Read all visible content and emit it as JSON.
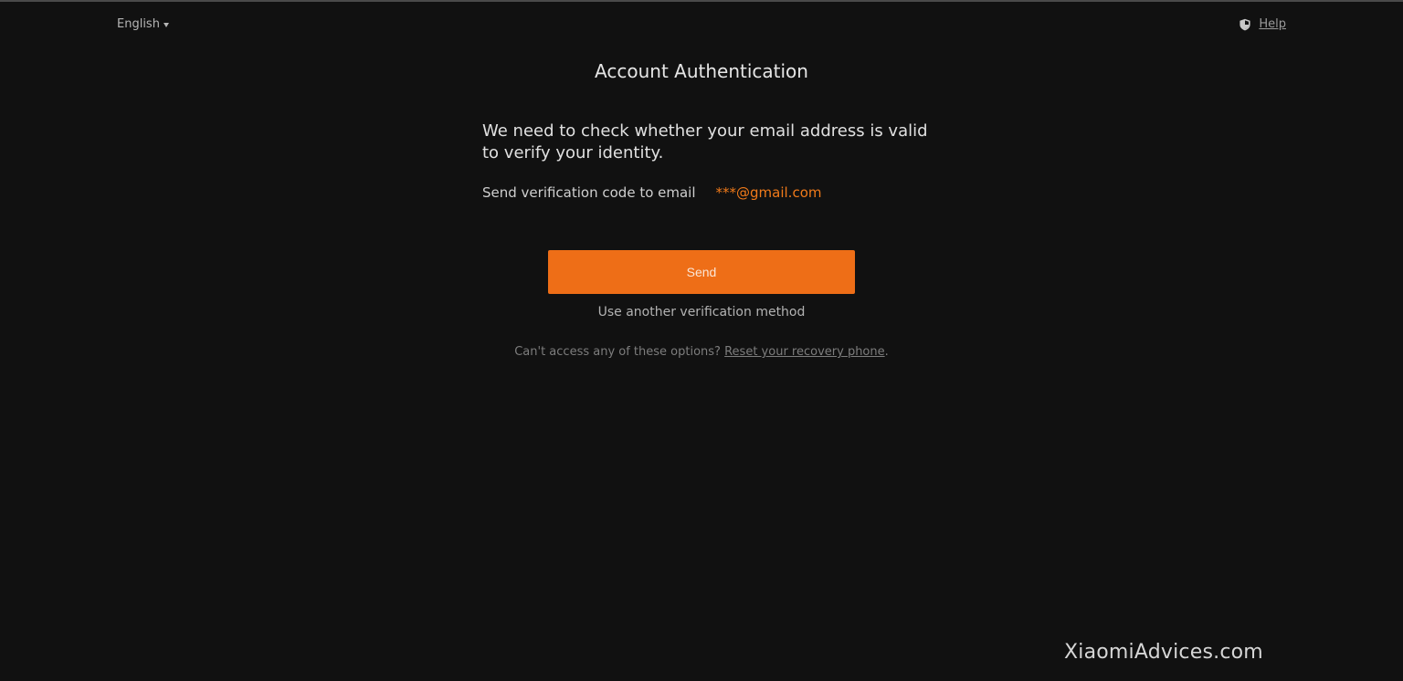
{
  "header": {
    "language": "English",
    "help_label": "Help"
  },
  "main": {
    "title": "Account Authentication",
    "description": "We need to check whether your email address is valid to verify your identity.",
    "email_label": "Send verification code to email",
    "email_value": "***@gmail.com",
    "send_label": "Send",
    "alt_method_label": "Use another verification method",
    "recovery_prefix": "Can't access any of these options?",
    "recovery_link": "Reset your recovery phone",
    "recovery_suffix": "."
  },
  "watermark": "XiaomiAdvices.com",
  "colors": {
    "background": "#111111",
    "accent": "#ee6e17",
    "email_text": "#f07a1a"
  },
  "icons": {
    "language_dropdown": "chevron-down-icon",
    "help": "shield-icon"
  }
}
